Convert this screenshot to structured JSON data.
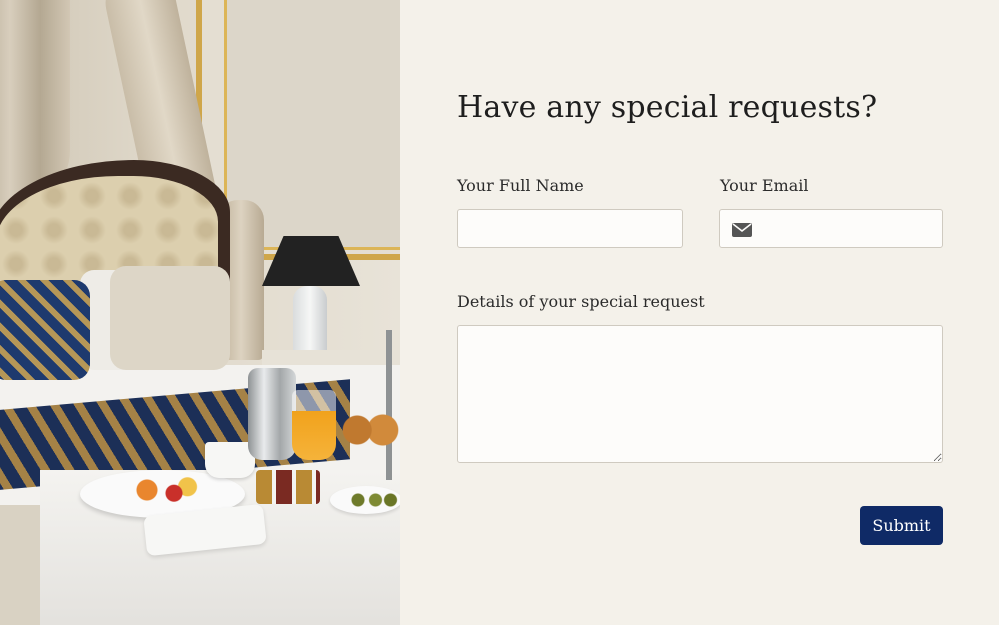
{
  "photo": {
    "alt_subject": "hotel-room-breakfast-photo"
  },
  "form": {
    "title": "Have any special requests?",
    "name_label": "Your Full Name",
    "name_value": "",
    "email_label": "Your Email",
    "email_value": "",
    "email_icon": "envelope-icon",
    "details_label": "Details of your special request",
    "details_value": "",
    "submit_label": "Submit"
  },
  "colors": {
    "background": "#f4f1ea",
    "submit_button": "#0f2a66",
    "field_background": "#fdfcfa",
    "field_border": "#cfcac0"
  }
}
